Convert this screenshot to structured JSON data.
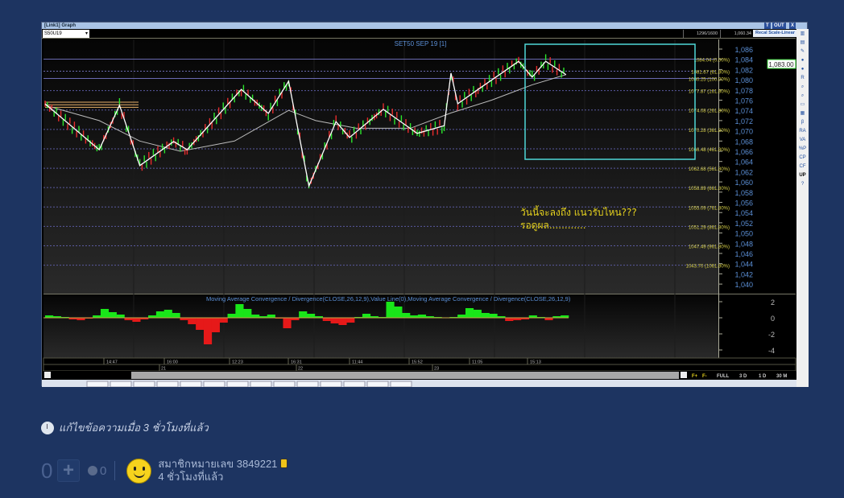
{
  "window": {
    "title": "[Link1] Graph",
    "btn_t": "T",
    "btn_out": "OUT",
    "btn_x": "X"
  },
  "toolbar": {
    "symbol": "S50U19",
    "cell1": "1296/1600",
    "cell2": "1,060.34",
    "recal": "Recal Scale-Linear"
  },
  "chart_data": {
    "type": "line",
    "title": "SET50 SEP 19   [1]",
    "ylim": [
      1039,
      1087.5
    ],
    "yticks": [
      1086,
      1084,
      1082,
      1080,
      1078,
      1076,
      1074,
      1072,
      1070,
      1068,
      1066,
      1064,
      1062,
      1060,
      1058,
      1056,
      1054,
      1052,
      1050,
      1048,
      1046,
      1044,
      1042,
      1040
    ],
    "ytick_labels": [
      "1,086",
      "1,084",
      "1,082",
      "1,080",
      "1,078",
      "1,076",
      "1,074",
      "1,072",
      "1,070",
      "1,068",
      "1,066",
      "1,064",
      "1,062",
      "1,060",
      "1,058",
      "1,056",
      "1,054",
      "1,052",
      "1,050",
      "1,048",
      "1,046",
      "1,044",
      "1,042",
      "1,040"
    ],
    "last_price": "1,083.00",
    "fib_levels": [
      {
        "value": 1084.04,
        "label": "1084.04 (0.00%)"
      },
      {
        "value": 1081.67,
        "label": "1081.67 (61.80%)"
      },
      {
        "value": 1080.25,
        "label": "1080.25 (100.00%)"
      },
      {
        "value": 1077.87,
        "label": "1077.87 (161.80%)"
      },
      {
        "value": 1074.08,
        "label": "1074.08 (261.80%)"
      },
      {
        "value": 1070.28,
        "label": "1070.28 (361.80%)"
      },
      {
        "value": 1066.48,
        "label": "1066.48 (461.80%)"
      },
      {
        "value": 1062.68,
        "label": "1062.68 (561.80%)"
      },
      {
        "value": 1058.89,
        "label": "1058.89 (661.80%)"
      },
      {
        "value": 1055.09,
        "label": "1055.09 (761.80%)"
      },
      {
        "value": 1051.29,
        "label": "1051.29 (861.80%)"
      },
      {
        "value": 1047.49,
        "label": "1047.49 (961.80%)"
      },
      {
        "value": 1043.7,
        "label": "1043.70 (1061.80%)"
      }
    ],
    "zigzag": {
      "x": [
        0,
        8,
        11,
        14,
        19,
        21,
        29,
        33,
        36,
        39,
        43,
        45,
        50,
        55,
        59,
        60,
        61,
        64,
        70,
        72,
        74,
        77
      ],
      "y": [
        1075.3,
        1066.3,
        1075,
        1063.2,
        1067.9,
        1066.3,
        1078.1,
        1073.4,
        1079.7,
        1059.2,
        1071.8,
        1068.7,
        1074.2,
        1069.5,
        1071,
        1081.3,
        1075.3,
        1078.1,
        1083.6,
        1080.5,
        1083.6,
        1081
      ]
    },
    "moving_average": {
      "x": [
        0,
        8,
        14,
        20,
        28,
        36,
        40,
        46,
        54,
        60,
        66,
        72,
        77
      ],
      "y": [
        1075,
        1072,
        1068,
        1066,
        1068,
        1074,
        1072,
        1070.5,
        1070.5,
        1073.5,
        1076,
        1079,
        1081
      ]
    },
    "time_labels": [
      "14:47",
      "16:00",
      "12:23",
      "16:31",
      "11:44",
      "15:52",
      "11:05",
      "15:13"
    ],
    "date_labels": [
      "21",
      "22",
      "23"
    ],
    "annotation": [
      "วันนี้จะลงถึง แนวรับไหน???",
      "รอดูผล............"
    ],
    "macd": {
      "title": "Moving Average Convergence / Divergence(CLOSE,26,12,9),Value Line(0),Moving Average Convergence / Divergence(CLOSE,26,12,9)",
      "ylim": [
        -5,
        2.5
      ],
      "yticks": [
        2,
        0,
        -2,
        -4
      ],
      "ytick_labels": [
        "2",
        "0",
        "-2",
        "-4"
      ],
      "values": [
        0.3,
        0.2,
        0.1,
        -0.2,
        -0.3,
        -0.1,
        0.3,
        1.1,
        0.7,
        0.4,
        -0.3,
        -0.5,
        -0.2,
        0.3,
        0.8,
        1,
        0.6,
        -0.3,
        -0.8,
        -1.5,
        -3.3,
        -1.8,
        -0.6,
        0.5,
        1.7,
        1.1,
        0.4,
        0.2,
        0.4,
        -0.1,
        -1.3,
        -0.3,
        0.8,
        0.5,
        0.2,
        -0.4,
        -0.7,
        -0.9,
        -0.6,
        0.1,
        0.5,
        0.2,
        0.1,
        2,
        1.4,
        0.6,
        0.3,
        0.4,
        0.2,
        0.1,
        0,
        0.1,
        0.4,
        1.2,
        1,
        0.6,
        0.5,
        0.2,
        -0.4,
        -0.3,
        -0.2,
        0.3,
        0.1,
        -0.3,
        0.2,
        0.3
      ]
    }
  },
  "scrollbar": {
    "f1": "F+",
    "f2": "F-",
    "full": "FULL",
    "d3": "3 D",
    "d1": "1 D",
    "m30": "30 M"
  },
  "sidebar_icons": [
    "layout-icon",
    "save-icon",
    "edit-icon",
    "zoom-in-icon",
    "zoom-out-icon",
    "R",
    "search-icon",
    "search-icon",
    "window-icon",
    "calendar-icon",
    "β",
    "RA",
    "VA",
    "%P",
    "CP",
    "CF",
    "UP",
    "help-icon"
  ],
  "sidebar_labels": {
    "r": "R",
    "beta": "β",
    "ra": "RA",
    "va": "VA",
    "pp": "%P",
    "cp": "CP",
    "cf": "CF",
    "up": "UP",
    "help": "?"
  },
  "post": {
    "edited": "แก้ไขข้อความเมื่อ 3 ชั่วโมงที่แล้ว",
    "score": "0",
    "reaction_count": "0",
    "username": "สมาชิกหมายเลข 3849221",
    "time": "4 ชั่วโมงที่แล้ว"
  },
  "colors": {
    "page_bg": "#1d3461",
    "fib": "#d9d24a",
    "box": "#4fd7d7",
    "macd_pos": "#19e619",
    "macd_neg": "#e61919",
    "axis_text": "#5b8fd6"
  }
}
